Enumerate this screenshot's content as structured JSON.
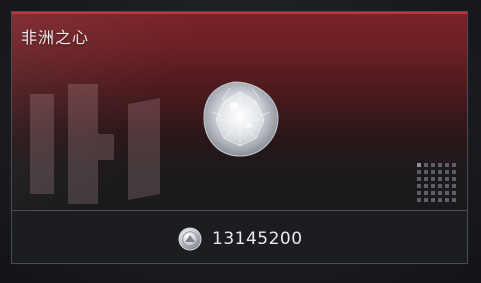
{
  "item": {
    "title": "非洲之心",
    "price": "13145200",
    "icons": {
      "item_image": "pear-shaped-diamond-icon",
      "currency": "silver-coin-icon",
      "rarity_or_grid": "grid-icon"
    }
  },
  "colors": {
    "accent_top": "#c8313a",
    "art_gradient_top": "#7a2227",
    "card_bg": "#1b1d22",
    "text_primary": "#f1e9e9",
    "price_text": "#e9eaee"
  }
}
